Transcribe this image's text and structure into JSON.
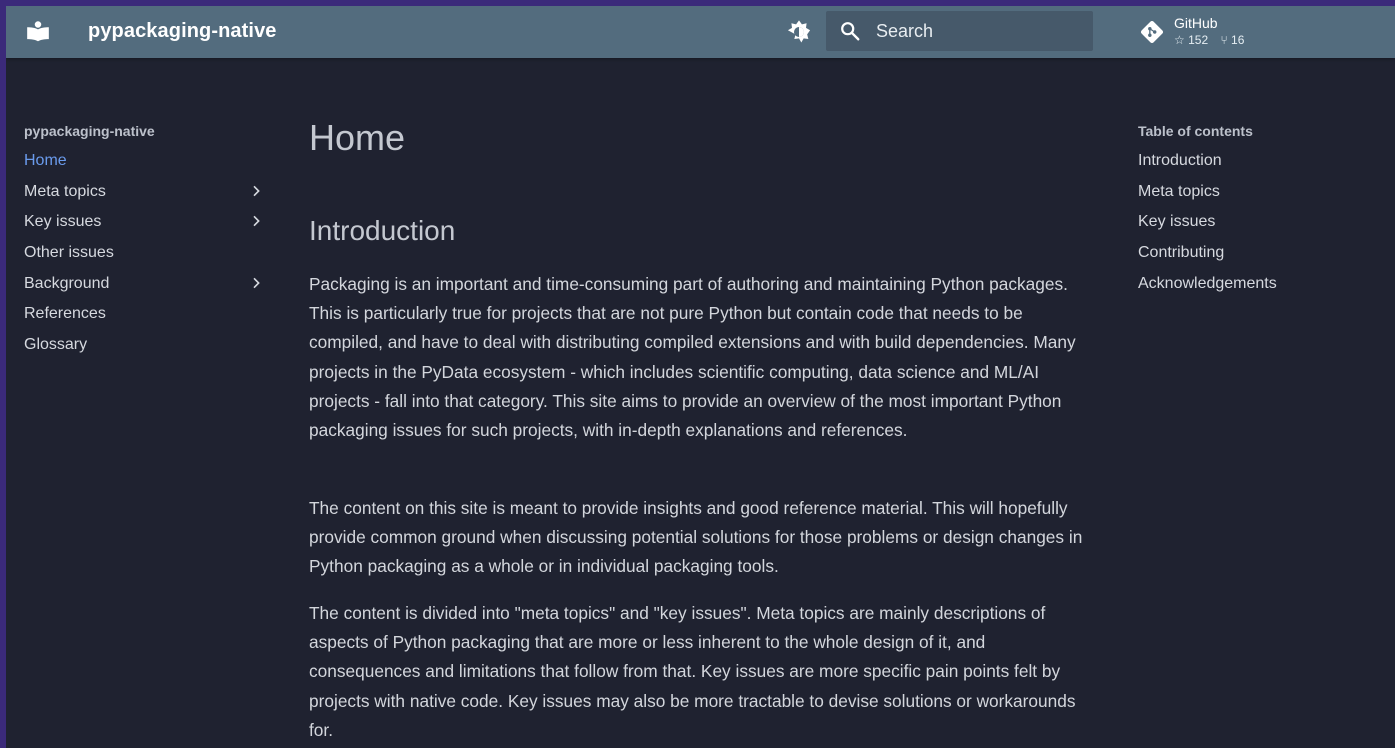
{
  "header": {
    "site_title": "pypackaging-native",
    "search": {
      "placeholder": "Search"
    },
    "repo": {
      "name": "GitHub",
      "stars": "152",
      "forks": "16"
    }
  },
  "nav": {
    "title": "pypackaging-native",
    "items": [
      {
        "label": "Home",
        "active": true,
        "expandable": false
      },
      {
        "label": "Meta topics",
        "active": false,
        "expandable": true
      },
      {
        "label": "Key issues",
        "active": false,
        "expandable": true
      },
      {
        "label": "Other issues",
        "active": false,
        "expandable": false
      },
      {
        "label": "Background",
        "active": false,
        "expandable": true
      },
      {
        "label": "References",
        "active": false,
        "expandable": false
      },
      {
        "label": "Glossary",
        "active": false,
        "expandable": false
      }
    ]
  },
  "content": {
    "title": "Home",
    "section_heading": "Introduction",
    "paragraphs": [
      "Packaging is an important and time-consuming part of authoring and maintaining Python packages. This is particularly true for projects that are not pure Python but contain code that needs to be compiled, and have to deal with distributing compiled extensions and with build dependencies. Many projects in the PyData ecosystem - which includes scientific computing, data science and ML/AI projects - fall into that category. This site aims to provide an overview of the most important Python packaging issues for such projects, with in-depth explanations and references.",
      "The content on this site is meant to provide insights and good reference material. This will hopefully provide common ground when discussing potential solutions for those problems or design changes in Python packaging as a whole or in individual packaging tools.",
      "The content is divided into \"meta topics\" and \"key issues\". Meta topics are mainly descriptions of aspects of Python packaging that are more or less inherent to the whole design of it, and consequences and limitations that follow from that. Key issues are more specific pain points felt by projects with native code. Key issues may also be more tractable to devise solutions or workarounds for."
    ]
  },
  "toc": {
    "title": "Table of contents",
    "items": [
      "Introduction",
      "Meta topics",
      "Key issues",
      "Contributing",
      "Acknowledgements"
    ]
  },
  "colors": {
    "header_bg": "#536c7e",
    "page_bg": "#1f2230",
    "accent": "#6a9bec",
    "outer_frame": "#3b2a7a"
  },
  "icons": [
    "book-logo-icon",
    "brightness-toggle-icon",
    "search-icon",
    "git-icon",
    "star-icon",
    "fork-icon",
    "chevron-right-icon"
  ]
}
